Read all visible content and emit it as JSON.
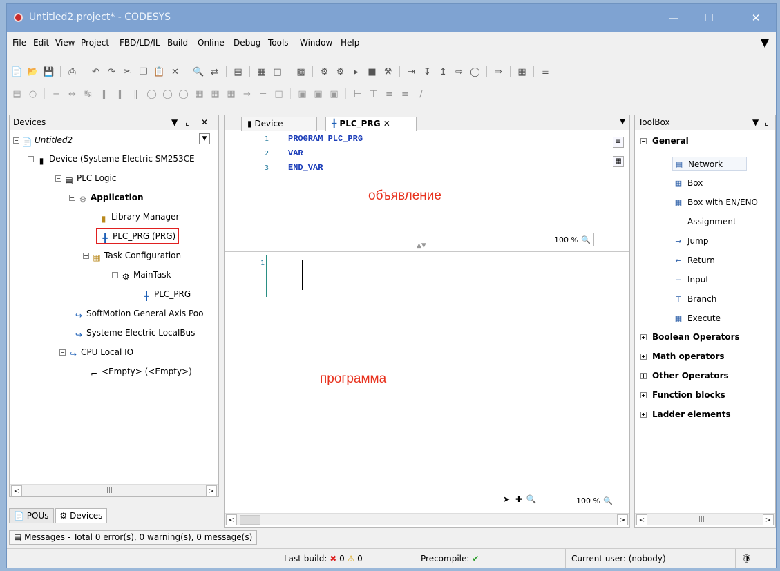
{
  "window": {
    "title": "Untitled2.project* - CODESYS",
    "min_icon": "minimize-icon",
    "max_icon": "maximize-icon",
    "close_icon": "close-icon"
  },
  "menu": {
    "items": [
      "File",
      "Edit",
      "View",
      "Project",
      "FBD/LD/IL",
      "Build",
      "Online",
      "Debug",
      "Tools",
      "Window",
      "Help"
    ]
  },
  "devices_panel": {
    "title": "Devices",
    "tree": {
      "root": "Untitled2",
      "device": "Device (Systeme Electric SM253CE",
      "plc_logic": "PLC Logic",
      "application": "Application",
      "library_manager": "Library Manager",
      "plc_prg": "PLC_PRG (PRG)",
      "task_configuration": "Task Configuration",
      "main_task": "MainTask",
      "task_plc_prg": "PLC_PRG",
      "softmotion": "SoftMotion General Axis Poo",
      "localbus": "Systeme Electric LocalBus",
      "cpu_local_io": "CPU Local IO",
      "empty": "<Empty> (<Empty>)"
    }
  },
  "bottom_tabs": [
    "POUs",
    "Devices"
  ],
  "editor": {
    "tabs": [
      {
        "label": "Device"
      },
      {
        "label": "PLC_PRG"
      }
    ],
    "declaration": {
      "lines": [
        {
          "num": "1",
          "text": "PROGRAM PLC_PRG"
        },
        {
          "num": "2",
          "text": "VAR"
        },
        {
          "num": "3",
          "text": "END_VAR"
        }
      ],
      "label": "объявление",
      "zoom": "100 %"
    },
    "implementation": {
      "line_num": "1",
      "label": "программа",
      "zoom": "100 %"
    }
  },
  "toolbox": {
    "title": "ToolBox",
    "general": "General",
    "items": [
      "Network",
      "Box",
      "Box with EN/ENO",
      "Assignment",
      "Jump",
      "Return",
      "Input",
      "Branch",
      "Execute"
    ],
    "sections": [
      "Boolean Operators",
      "Math operators",
      "Other Operators",
      "Function blocks",
      "Ladder elements"
    ]
  },
  "messages": {
    "text": "Messages - Total 0 error(s), 0 warning(s), 0 message(s)"
  },
  "status": {
    "last_build_label": "Last build:",
    "errors": "0",
    "warnings": "0",
    "precompile_label": "Precompile:",
    "current_user": "Current user: (nobody)"
  },
  "colors": {
    "titlebar": "#7fa3d2",
    "keyword": "#1a3cb8",
    "annotation": "#e8321e",
    "highlight_box": "#e02020"
  }
}
